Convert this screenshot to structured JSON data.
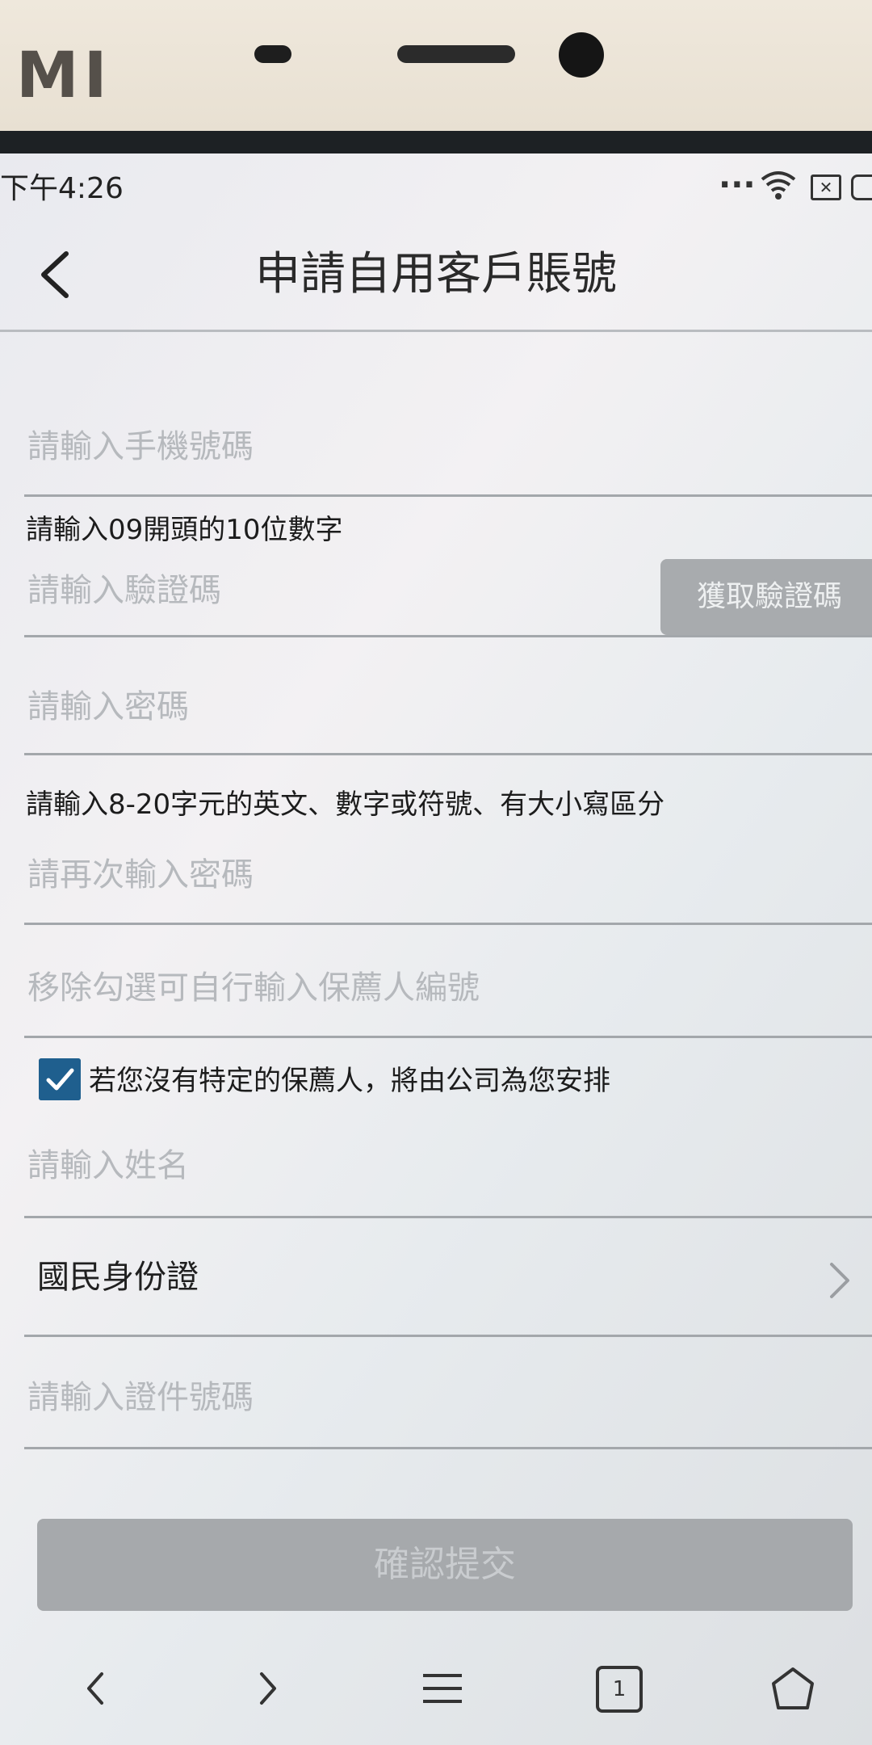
{
  "device": {
    "brand_logo": "MI"
  },
  "status_bar": {
    "time": "下午4:26",
    "more_dots": "...",
    "icons": [
      "wifi-icon",
      "no-sim-icon",
      "battery-icon"
    ]
  },
  "header": {
    "title": "申請自用客戶賬號",
    "back_icon": "chevron-left-icon"
  },
  "form": {
    "phone": {
      "placeholder": "請輸入手機號碼",
      "hint": "請輸入09開頭的10位數字"
    },
    "verification_code": {
      "placeholder": "請輸入驗證碼",
      "button_label": "獲取驗證碼"
    },
    "password": {
      "placeholder": "請輸入密碼",
      "hint": "請輸入8-20字元的英文、數字或符號、有大小寫區分"
    },
    "confirm_password": {
      "placeholder": "請再次輸入密碼"
    },
    "referrer": {
      "placeholder": "移除勾選可自行輸入保薦人編號",
      "checkbox_checked": true,
      "checkbox_label": "若您沒有特定的保薦人，將由公司為您安排"
    },
    "name": {
      "placeholder": "請輸入姓名"
    },
    "id_type": {
      "value": "國民身份證",
      "icon": "chevron-right-icon"
    },
    "id_number": {
      "placeholder": "請輸入證件號碼"
    },
    "submit_label": "確認提交"
  },
  "navbar": {
    "items": [
      "back-nav-icon",
      "forward-nav-icon",
      "menu-icon",
      "tabs-icon",
      "home-icon"
    ],
    "tabs_count": "1"
  },
  "colors": {
    "checkbox": "#1f5f8e",
    "disabled_button": "#a6a9ac",
    "placeholder_text": "#b6b9bd"
  }
}
